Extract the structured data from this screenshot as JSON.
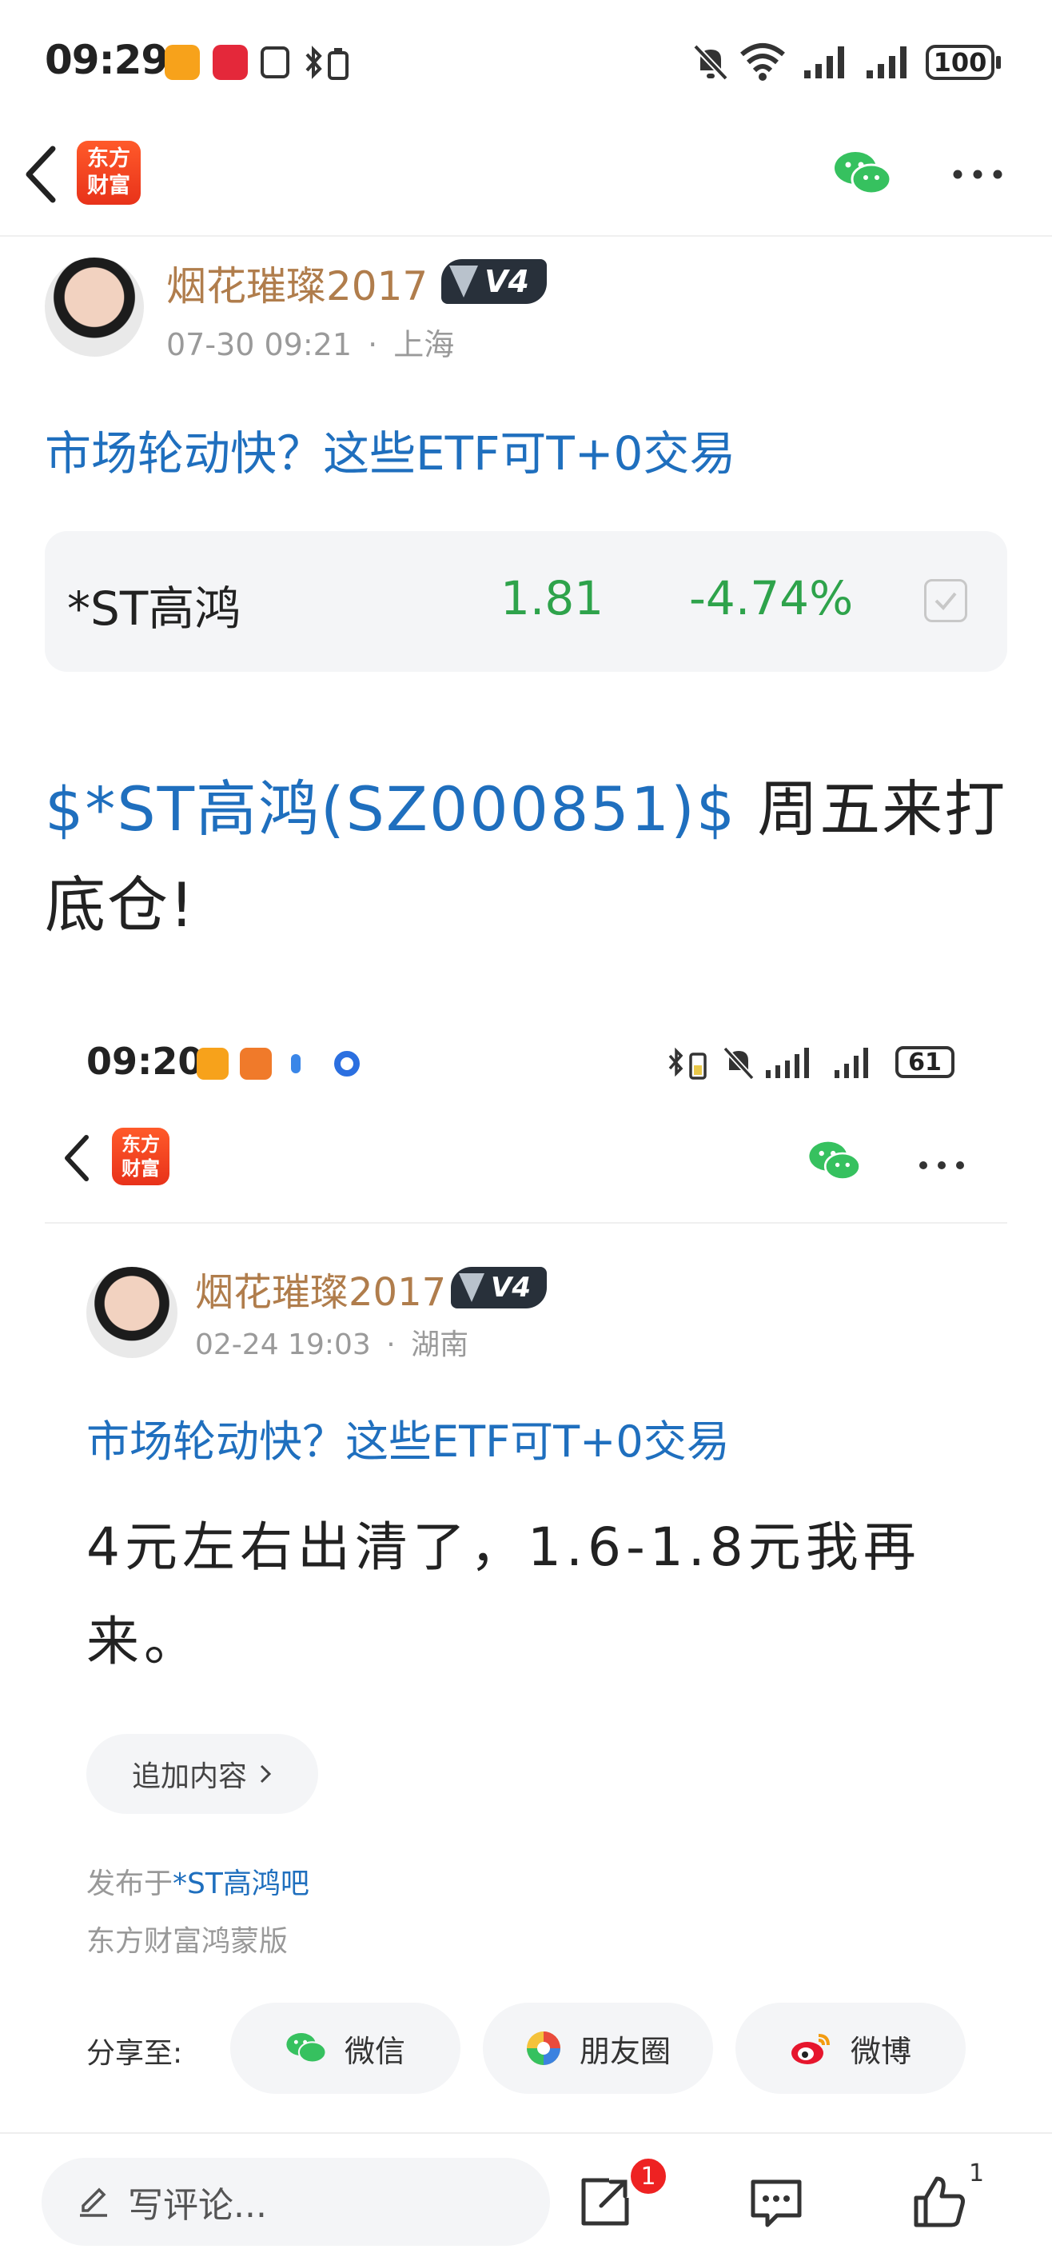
{
  "status_bar": {
    "time": "09:29",
    "battery": "100"
  },
  "header": {
    "logo_line1": "东方",
    "logo_line2": "财富"
  },
  "post": {
    "username": "烟花璀璨2017",
    "level": "V4",
    "date": "07-30 09:21",
    "sep": "·",
    "location": "上海",
    "promo_title": "市场轮动快？这些ETF可T+0交易",
    "stock": {
      "name": "*ST高鸿",
      "price": "1.81",
      "change": "-4.74%"
    },
    "body_link": "$*ST高鸿(SZ000851)$",
    "body_text": " 周五来打底仓!"
  },
  "embedded": {
    "status_bar": {
      "time": "09:20",
      "battery": "61"
    },
    "header": {
      "logo_line1": "东方",
      "logo_line2": "财富"
    },
    "post": {
      "username": "烟花璀璨2017",
      "level": "V4",
      "date": "02-24 19:03",
      "sep": "·",
      "location": "湖南",
      "promo_title": "市场轮动快？这些ETF可T+0交易",
      "body": "4元左右出清了，1.6-1.8元我再来。",
      "append_button": "追加内容",
      "published_prefix": "发布于",
      "published_bar": "*ST高鸿吧",
      "client": "东方财富鸿蒙版",
      "share_label": "分享至:",
      "share_wechat": "微信",
      "share_moments": "朋友圈",
      "share_weibo": "微博"
    }
  },
  "bottom_bar": {
    "comment_placeholder": "写评论...",
    "share_badge": "1",
    "like_count": "1"
  },
  "colors": {
    "link_blue": "#1f6fbe",
    "stock_green": "#2ea34b",
    "username_gold": "#b07d4c",
    "logo_orange": "#ff5a2a",
    "badge_red": "#e22222"
  }
}
